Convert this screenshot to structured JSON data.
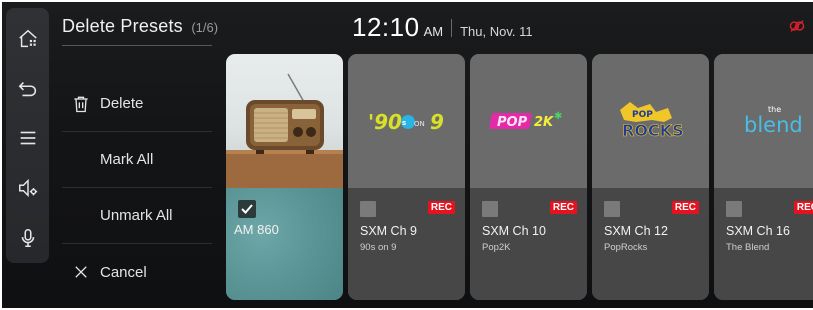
{
  "header": {
    "title": "Delete Presets",
    "count": "(1/6)",
    "time": "12:10",
    "ampm": "AM",
    "date": "Thu, Nov. 11"
  },
  "rail": {
    "icons": [
      "home-apps-icon",
      "back-icon",
      "menu-icon",
      "sound-settings-icon",
      "microphone-icon"
    ]
  },
  "status_icons": [
    "connectivity-off-icon"
  ],
  "menu": {
    "delete": "Delete",
    "mark_all": "Mark All",
    "unmark_all": "Unmark All",
    "cancel": "Cancel"
  },
  "presets": [
    {
      "name": "AM 860",
      "sub": "",
      "rec": "",
      "checked": true,
      "art": "vintage-radio"
    },
    {
      "name": "SXM Ch 9",
      "sub": "90s on 9",
      "rec": "REC",
      "checked": false,
      "art": "90s-on-9-logo"
    },
    {
      "name": "SXM Ch 10",
      "sub": "Pop2K",
      "rec": "REC",
      "checked": false,
      "art": "pop2k-logo"
    },
    {
      "name": "SXM Ch 12",
      "sub": "PopRocks",
      "rec": "REC",
      "checked": false,
      "art": "poprocks-logo"
    },
    {
      "name": "SXM Ch 16",
      "sub": "The Blend",
      "rec": "REC",
      "checked": false,
      "art": "the-blend-logo"
    }
  ],
  "colors": {
    "rec_badge": "#e3141f",
    "status_icon": "#e0202a",
    "selected_card": "#5c9697"
  }
}
